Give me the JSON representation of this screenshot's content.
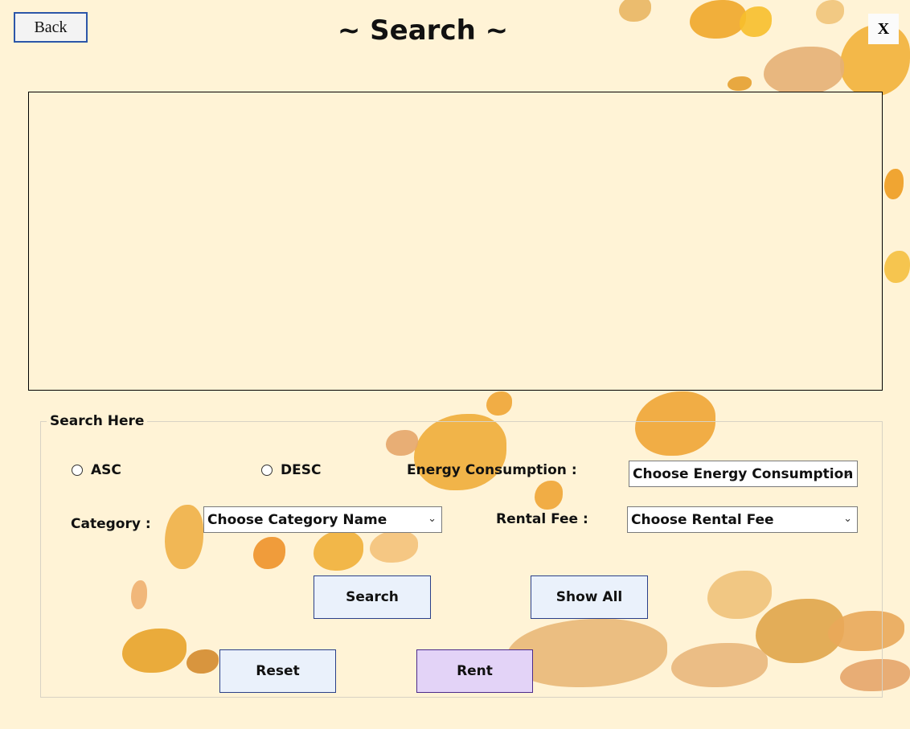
{
  "header": {
    "back_label": "Back",
    "title": "~ Search ~",
    "close_label": "X"
  },
  "search_group": {
    "legend": "Search Here",
    "sort_asc": "ASC",
    "sort_desc": "DESC",
    "energy_label": "Energy Consumption :",
    "energy_select": "Choose Energy Consumption",
    "category_label": "Category :",
    "category_select": "Choose Category Name",
    "rental_label": "Rental Fee :",
    "rental_select": "Choose Rental Fee"
  },
  "buttons": {
    "search": "Search",
    "show_all": "Show All",
    "reset": "Reset",
    "rent": "Rent"
  },
  "icons": {
    "dropdown": "chevron-down-icon"
  },
  "colors": {
    "background": "#fff3d6",
    "button_bg": "#eaf1fb",
    "rent_bg": "#e3d3f7",
    "leaf": "#e8a32a"
  }
}
